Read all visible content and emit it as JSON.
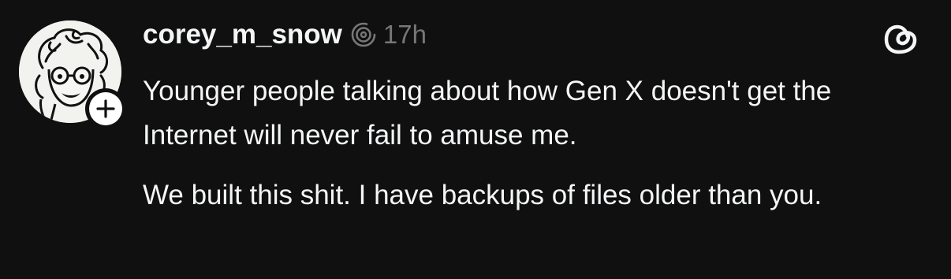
{
  "post": {
    "username": "corey_m_snow",
    "timestamp": "17h",
    "paragraph_1": "Younger people talking about how Gen X doesn't get the Internet will never fail to amuse me.",
    "paragraph_2": "We built this shit. I have backups of files older than you."
  },
  "icons": {
    "verified": "threads-verified-swirl-icon",
    "follow": "plus-icon",
    "app_logo": "threads-logo-icon"
  },
  "colors": {
    "background": "#101010",
    "text": "#f3f5f7",
    "muted": "#777777"
  }
}
